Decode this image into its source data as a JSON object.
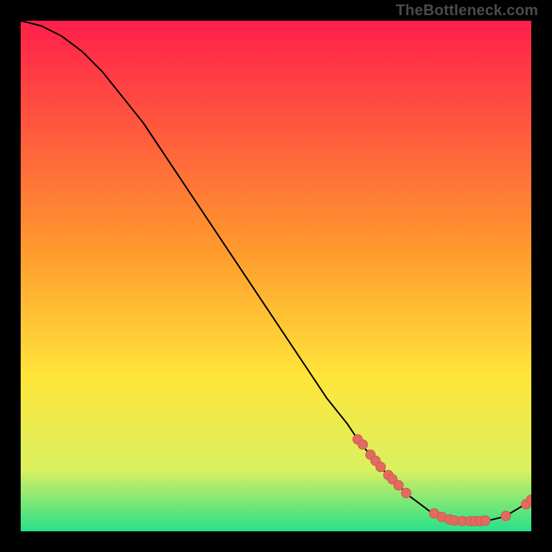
{
  "watermark": "TheBottleneck.com",
  "colors": {
    "gradient_top": "#ff1f4b",
    "gradient_mid": "#ffd22e",
    "gradient_bottom": "#27e08a",
    "curve": "#000000",
    "points_fill": "#e26a5f",
    "points_stroke": "#c85a50",
    "bg": "#000000"
  },
  "chart_data": {
    "type": "line",
    "xlabel": "",
    "ylabel": "",
    "xlim": [
      0,
      100
    ],
    "ylim": [
      0,
      100
    ],
    "title": "",
    "curve": [
      {
        "x": 0,
        "y": 100
      },
      {
        "x": 4,
        "y": 99
      },
      {
        "x": 8,
        "y": 97
      },
      {
        "x": 12,
        "y": 94
      },
      {
        "x": 16,
        "y": 90
      },
      {
        "x": 20,
        "y": 85
      },
      {
        "x": 24,
        "y": 80
      },
      {
        "x": 28,
        "y": 74
      },
      {
        "x": 32,
        "y": 68
      },
      {
        "x": 36,
        "y": 62
      },
      {
        "x": 40,
        "y": 56
      },
      {
        "x": 44,
        "y": 50
      },
      {
        "x": 48,
        "y": 44
      },
      {
        "x": 52,
        "y": 38
      },
      {
        "x": 56,
        "y": 32
      },
      {
        "x": 60,
        "y": 26
      },
      {
        "x": 64,
        "y": 21
      },
      {
        "x": 66,
        "y": 18
      },
      {
        "x": 68,
        "y": 15.5
      },
      {
        "x": 70,
        "y": 13
      },
      {
        "x": 72,
        "y": 11
      },
      {
        "x": 74,
        "y": 9
      },
      {
        "x": 76,
        "y": 7
      },
      {
        "x": 78,
        "y": 5.5
      },
      {
        "x": 80,
        "y": 4
      },
      {
        "x": 82,
        "y": 3
      },
      {
        "x": 84,
        "y": 2.3
      },
      {
        "x": 86,
        "y": 2
      },
      {
        "x": 88,
        "y": 2
      },
      {
        "x": 90,
        "y": 2
      },
      {
        "x": 92,
        "y": 2.2
      },
      {
        "x": 94,
        "y": 2.7
      },
      {
        "x": 96,
        "y": 3.6
      },
      {
        "x": 98,
        "y": 4.8
      },
      {
        "x": 100,
        "y": 6.2
      }
    ],
    "points": [
      {
        "x": 66,
        "y": 18
      },
      {
        "x": 67,
        "y": 17
      },
      {
        "x": 68.5,
        "y": 15
      },
      {
        "x": 69.5,
        "y": 13.8
      },
      {
        "x": 70.5,
        "y": 12.6
      },
      {
        "x": 72,
        "y": 11
      },
      {
        "x": 72.8,
        "y": 10.2
      },
      {
        "x": 74,
        "y": 9
      },
      {
        "x": 75.5,
        "y": 7.5
      },
      {
        "x": 81,
        "y": 3.5
      },
      {
        "x": 82.5,
        "y": 2.8
      },
      {
        "x": 84,
        "y": 2.3
      },
      {
        "x": 85,
        "y": 2.1
      },
      {
        "x": 86.5,
        "y": 2
      },
      {
        "x": 88,
        "y": 2
      },
      {
        "x": 89,
        "y": 2
      },
      {
        "x": 90,
        "y": 2
      },
      {
        "x": 91,
        "y": 2.1
      },
      {
        "x": 95,
        "y": 3.0
      },
      {
        "x": 99,
        "y": 5.3
      },
      {
        "x": 100,
        "y": 6.2
      }
    ]
  }
}
